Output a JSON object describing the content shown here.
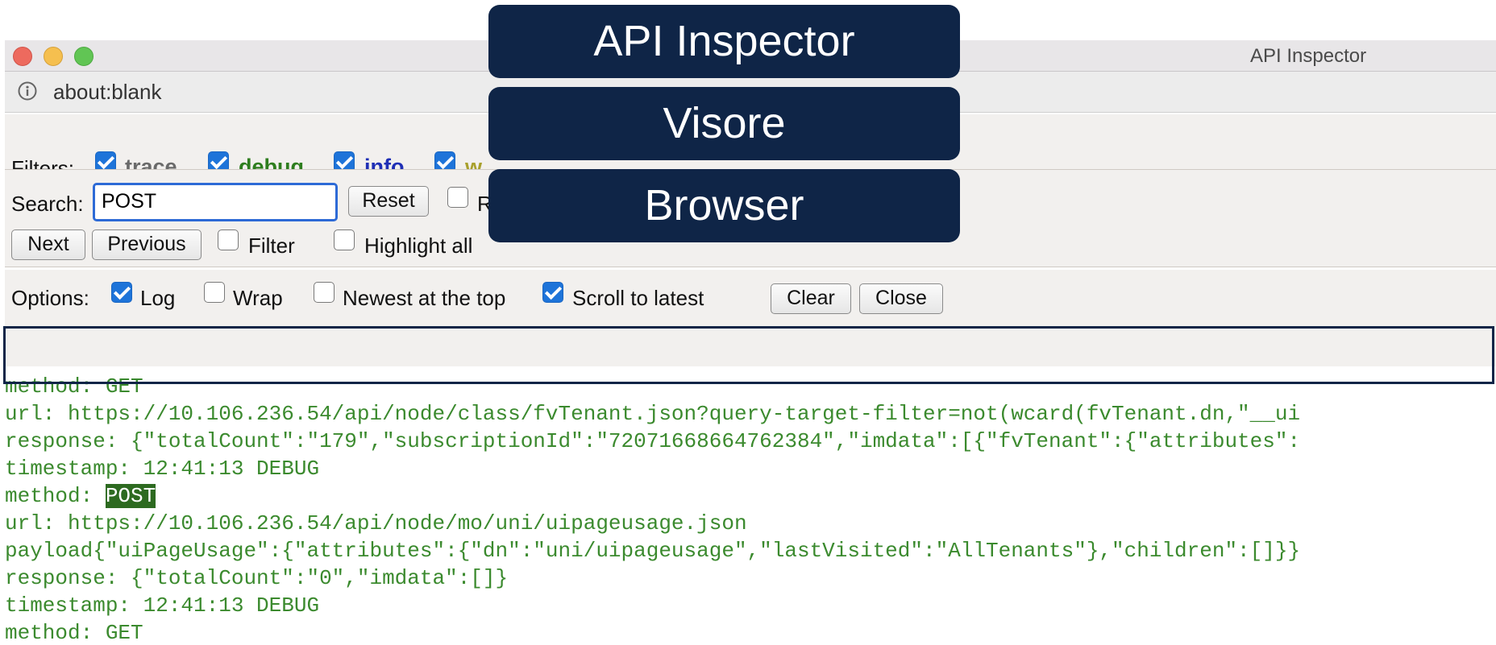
{
  "window": {
    "title": "API Inspector"
  },
  "url_bar": {
    "url": "about:blank",
    "icon": "info-icon"
  },
  "filters": {
    "label": "Filters:",
    "items": [
      {
        "label": "trace",
        "checked": true,
        "color": "#6a6a6a"
      },
      {
        "label": "debug",
        "checked": true,
        "color": "#2e7d1e"
      },
      {
        "label": "info",
        "checked": true,
        "color": "#1f2fb5"
      },
      {
        "label": "w",
        "checked": true,
        "color": "#a8a02c"
      }
    ]
  },
  "search": {
    "label": "Search:",
    "value": "POST",
    "reset_label": "Reset",
    "regex_label": "R",
    "next_label": "Next",
    "previous_label": "Previous",
    "filter_label": "Filter",
    "highlight_all_label": "Highlight all"
  },
  "options": {
    "label": "Options:",
    "log_label": "Log",
    "wrap_label": "Wrap",
    "newest_label": "Newest at the top",
    "scroll_label": "Scroll to latest",
    "clear_label": "Clear",
    "close_label": "Close"
  },
  "log": {
    "lines": [
      "method: GET",
      "url: https://10.106.236.54/api/node/class/fvTenant.json?query-target-filter=not(wcard(fvTenant.dn,\"__ui",
      "response: {\"totalCount\":\"179\",\"subscriptionId\":\"72071668664762384\",\"imdata\":[{\"fvTenant\":{\"attributes\":",
      "timestamp: 12:41:13 DEBUG",
      "method: ",
      "url: https://10.106.236.54/api/node/mo/uni/uipageusage.json",
      "payload{\"uiPageUsage\":{\"attributes\":{\"dn\":\"uni/uipageusage\",\"lastVisited\":\"AllTenants\"},\"children\":[]}}",
      "response: {\"totalCount\":\"0\",\"imdata\":[]}",
      "timestamp: 12:41:13 DEBUG",
      "method: GET"
    ],
    "highlight": "POST"
  },
  "overlay": {
    "items": [
      "API Inspector",
      "Visore",
      "Browser"
    ]
  }
}
